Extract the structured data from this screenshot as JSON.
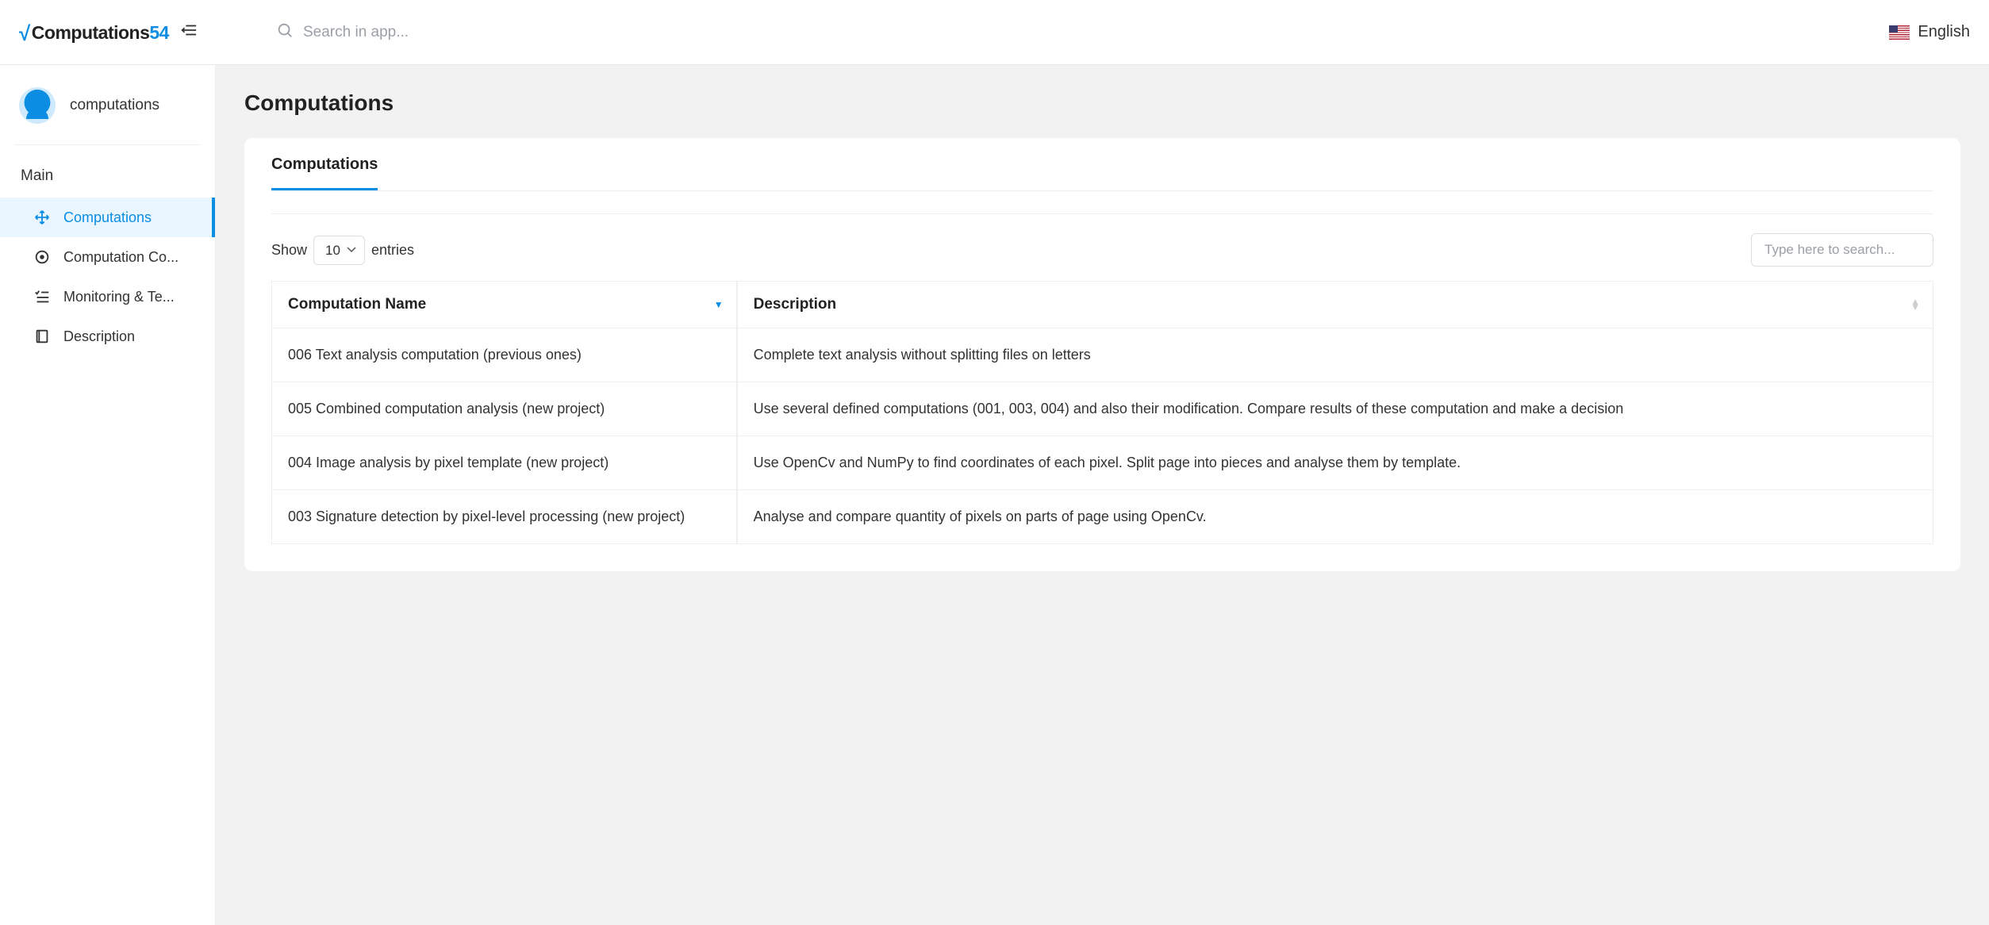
{
  "header": {
    "logo_prefix": "Computations",
    "logo_suffix": "54",
    "search_placeholder": "Search in app...",
    "language_label": "English"
  },
  "sidebar": {
    "profile_name": "computations",
    "section_title": "Main",
    "items": [
      {
        "label": "Computations",
        "icon": "move-icon",
        "active": true
      },
      {
        "label": "Computation Co...",
        "icon": "target-icon",
        "active": false
      },
      {
        "label": "Monitoring & Te...",
        "icon": "checklist-icon",
        "active": false
      },
      {
        "label": "Description",
        "icon": "book-icon",
        "active": false
      }
    ]
  },
  "page": {
    "title": "Computations",
    "card_tab": "Computations",
    "show_label_pre": "Show",
    "show_label_post": "entries",
    "show_value": "10",
    "table_search_placeholder": "Type here to search...",
    "columns": [
      {
        "label": "Computation Name",
        "sorted": "desc"
      },
      {
        "label": "Description",
        "sorted": "none"
      }
    ],
    "rows": [
      {
        "name": "006 Text analysis computation (previous ones)",
        "desc": "Complete text analysis without splitting files on letters"
      },
      {
        "name": "005 Combined computation analysis (new project)",
        "desc": "Use several defined computations (001, 003, 004) and also their modification. Compare results of these computation and make a decision"
      },
      {
        "name": "004 Image analysis by pixel template (new project)",
        "desc": "Use OpenCv and NumPy to find coordinates of each pixel. Split page into pieces and analyse them by template."
      },
      {
        "name": "003 Signature detection by pixel-level processing (new project)",
        "desc": "Analyse and compare quantity of pixels on parts of page using OpenCv."
      }
    ]
  }
}
